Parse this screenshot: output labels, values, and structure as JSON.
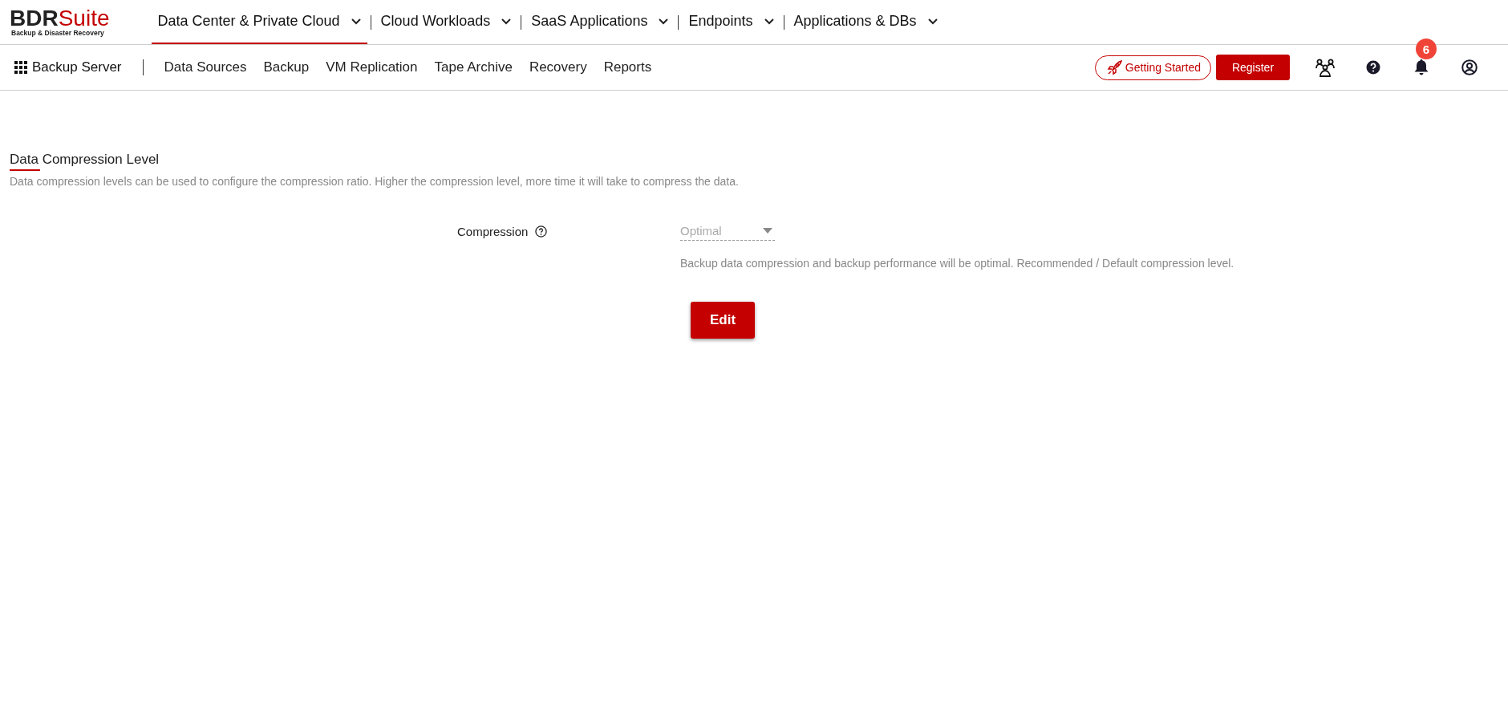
{
  "logo": {
    "brand_dark": "BDR",
    "brand_red": "Suite",
    "tagline": "Backup & Disaster Recovery"
  },
  "top_nav": [
    {
      "label": "Data Center & Private Cloud",
      "selected": true
    },
    {
      "label": "Cloud Workloads",
      "selected": false
    },
    {
      "label": "SaaS Applications",
      "selected": false
    },
    {
      "label": "Endpoints",
      "selected": false
    },
    {
      "label": "Applications & DBs",
      "selected": false
    }
  ],
  "sub_nav": {
    "app_title": "Backup Server",
    "items": [
      "Data Sources",
      "Backup",
      "VM Replication",
      "Tape Archive",
      "Recovery",
      "Reports"
    ]
  },
  "actions": {
    "getting_started": "Getting Started",
    "register": "Register",
    "notification_count": "6"
  },
  "section": {
    "title": "Data Compression Level",
    "description": "Data compression levels can be used to configure the compression ratio. Higher the compression level, more time it will take to compress the data."
  },
  "compression": {
    "label": "Compression",
    "value": "Optimal",
    "disabled": true,
    "hint": "Backup data compression and backup performance will be optimal. Recommended / Default compression level."
  },
  "buttons": [
    "Edit"
  ]
}
